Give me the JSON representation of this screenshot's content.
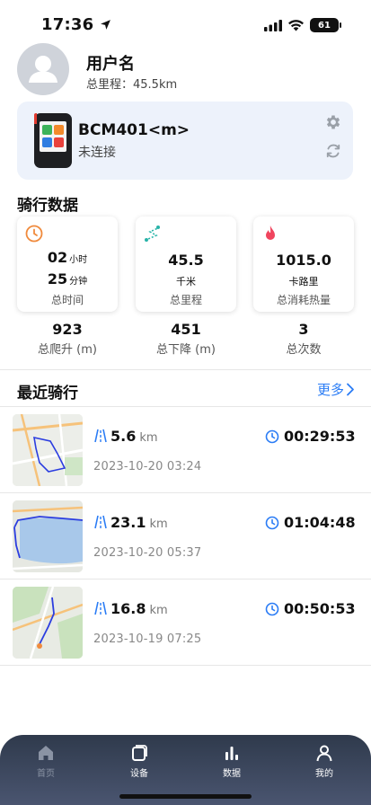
{
  "status_bar": {
    "time": "17:36",
    "battery": "61"
  },
  "profile": {
    "name": "用户名",
    "total_distance": "总里程：45.5km"
  },
  "device": {
    "name": "BCM401<m>",
    "status": "未连接"
  },
  "ride_data": {
    "title": "骑行数据",
    "cards": {
      "time": {
        "hours": "02",
        "hours_unit": "小时",
        "minutes": "25",
        "minutes_unit": "分钟",
        "label": "总时间"
      },
      "distance": {
        "value": "45.5",
        "unit": "千米",
        "label": "总里程"
      },
      "calories": {
        "value": "1015.0",
        "unit": "卡路里",
        "label": "总消耗热量"
      }
    },
    "mini": [
      {
        "value": "923",
        "label": "总爬升 (m)"
      },
      {
        "value": "451",
        "label": "总下降 (m)"
      },
      {
        "value": "3",
        "label": "总次数"
      }
    ]
  },
  "recent": {
    "title": "最近骑行",
    "more": "更多",
    "rides": [
      {
        "distance": "5.6",
        "unit": "km",
        "duration": "00:29:53",
        "date": "2023-10-20 03:24"
      },
      {
        "distance": "23.1",
        "unit": "km",
        "duration": "01:04:48",
        "date": "2023-10-20 05:37"
      },
      {
        "distance": "16.8",
        "unit": "km",
        "duration": "00:50:53",
        "date": "2023-10-19 07:25"
      }
    ]
  },
  "tabbar": {
    "items": [
      {
        "label": "首页",
        "icon": "home-icon"
      },
      {
        "label": "设备",
        "icon": "device-icon"
      },
      {
        "label": "数据",
        "icon": "bar-chart-icon"
      },
      {
        "label": "我的",
        "icon": "person-icon"
      }
    ]
  },
  "colors": {
    "accent": "#2a7cf5",
    "time_icon": "#f08a3c",
    "route_icon": "#27b3a8",
    "fire_icon": "#f0455e",
    "tabbar": "#3a4559"
  }
}
